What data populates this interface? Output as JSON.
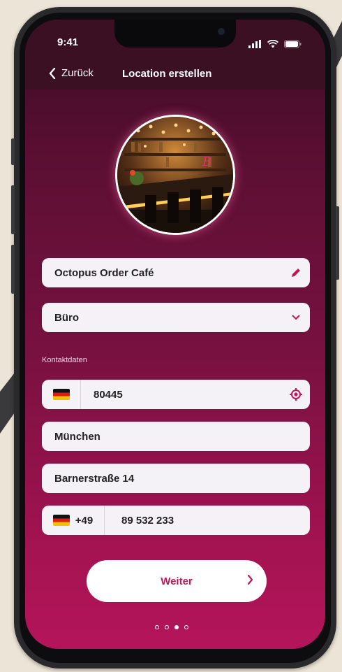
{
  "status": {
    "time": "9:41"
  },
  "nav": {
    "back_label": "Zurück",
    "title": "Location erstellen"
  },
  "form": {
    "name": "Octopus Order Café",
    "type": "Büro",
    "section_label": "Kontaktdaten",
    "zip": "80445",
    "city": "München",
    "street": "Barnerstraße 14",
    "phone_prefix": "+49",
    "phone_number": "89 532 233"
  },
  "actions": {
    "next_label": "Weiter"
  },
  "pagination": {
    "total": 4,
    "active": 3
  },
  "colors": {
    "accent": "#c4155a",
    "background_top": "#3a0b22",
    "background_bottom": "#b4155a"
  }
}
